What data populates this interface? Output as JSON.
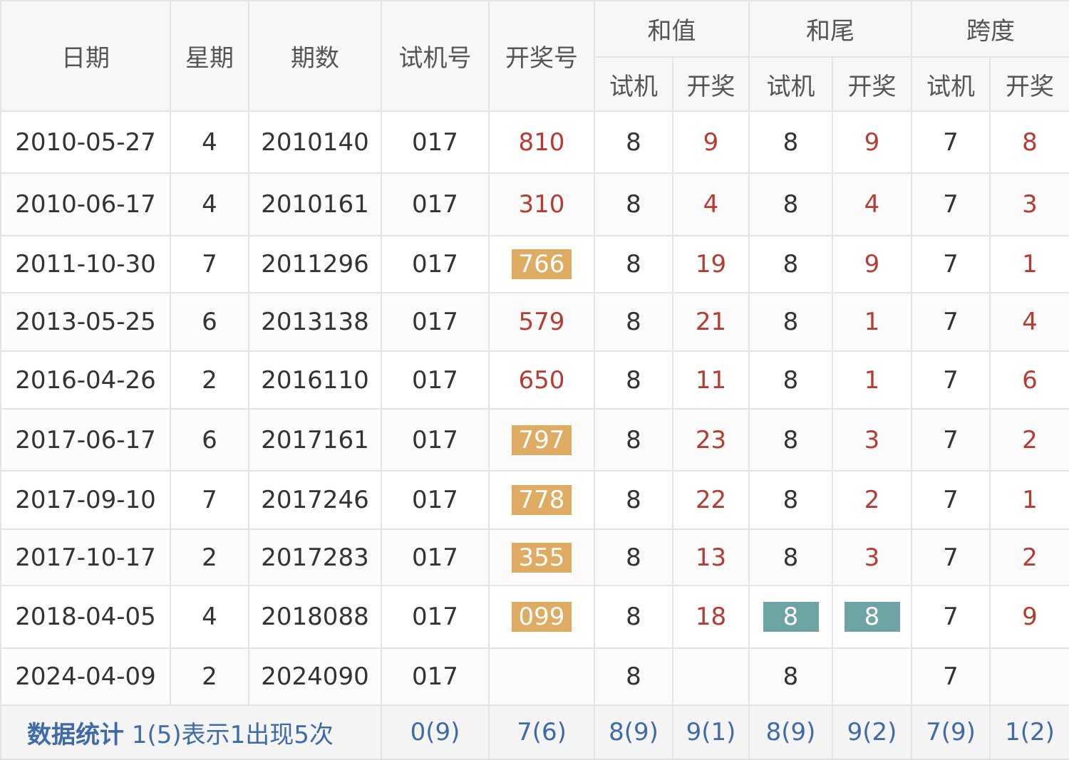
{
  "header": {
    "date": "日期",
    "weekday": "星期",
    "issue": "期数",
    "trial_number": "试机号",
    "draw_number": "开奖号",
    "sum_group": "和值",
    "tail_group": "和尾",
    "span_group": "跨度",
    "sub_trial": "试机",
    "sub_draw": "开奖"
  },
  "rows": [
    {
      "date": "2010-05-27",
      "weekday": "4",
      "issue": "2010140",
      "trial": "017",
      "draw": "810",
      "draw_hl": false,
      "sum_trial": "8",
      "sum_draw": "9",
      "tail_trial": "8",
      "tail_draw": "9",
      "tail_hl": false,
      "span_trial": "7",
      "span_draw": "8"
    },
    {
      "date": "2010-06-17",
      "weekday": "4",
      "issue": "2010161",
      "trial": "017",
      "draw": "310",
      "draw_hl": false,
      "sum_trial": "8",
      "sum_draw": "4",
      "tail_trial": "8",
      "tail_draw": "4",
      "tail_hl": false,
      "span_trial": "7",
      "span_draw": "3"
    },
    {
      "date": "2011-10-30",
      "weekday": "7",
      "issue": "2011296",
      "trial": "017",
      "draw": "766",
      "draw_hl": true,
      "sum_trial": "8",
      "sum_draw": "19",
      "tail_trial": "8",
      "tail_draw": "9",
      "tail_hl": false,
      "span_trial": "7",
      "span_draw": "1"
    },
    {
      "date": "2013-05-25",
      "weekday": "6",
      "issue": "2013138",
      "trial": "017",
      "draw": "579",
      "draw_hl": false,
      "sum_trial": "8",
      "sum_draw": "21",
      "tail_trial": "8",
      "tail_draw": "1",
      "tail_hl": false,
      "span_trial": "7",
      "span_draw": "4"
    },
    {
      "date": "2016-04-26",
      "weekday": "2",
      "issue": "2016110",
      "trial": "017",
      "draw": "650",
      "draw_hl": false,
      "sum_trial": "8",
      "sum_draw": "11",
      "tail_trial": "8",
      "tail_draw": "1",
      "tail_hl": false,
      "span_trial": "7",
      "span_draw": "6"
    },
    {
      "date": "2017-06-17",
      "weekday": "6",
      "issue": "2017161",
      "trial": "017",
      "draw": "797",
      "draw_hl": true,
      "sum_trial": "8",
      "sum_draw": "23",
      "tail_trial": "8",
      "tail_draw": "3",
      "tail_hl": false,
      "span_trial": "7",
      "span_draw": "2"
    },
    {
      "date": "2017-09-10",
      "weekday": "7",
      "issue": "2017246",
      "trial": "017",
      "draw": "778",
      "draw_hl": true,
      "sum_trial": "8",
      "sum_draw": "22",
      "tail_trial": "8",
      "tail_draw": "2",
      "tail_hl": false,
      "span_trial": "7",
      "span_draw": "1"
    },
    {
      "date": "2017-10-17",
      "weekday": "2",
      "issue": "2017283",
      "trial": "017",
      "draw": "355",
      "draw_hl": true,
      "sum_trial": "8",
      "sum_draw": "13",
      "tail_trial": "8",
      "tail_draw": "3",
      "tail_hl": false,
      "span_trial": "7",
      "span_draw": "2"
    },
    {
      "date": "2018-04-05",
      "weekday": "4",
      "issue": "2018088",
      "trial": "017",
      "draw": "099",
      "draw_hl": true,
      "sum_trial": "8",
      "sum_draw": "18",
      "tail_trial": "8",
      "tail_draw": "8",
      "tail_hl": true,
      "span_trial": "7",
      "span_draw": "9"
    },
    {
      "date": "2024-04-09",
      "weekday": "2",
      "issue": "2024090",
      "trial": "017",
      "draw": "",
      "draw_hl": false,
      "sum_trial": "8",
      "sum_draw": "",
      "tail_trial": "8",
      "tail_draw": "",
      "tail_hl": false,
      "span_trial": "7",
      "span_draw": ""
    }
  ],
  "footer": {
    "title": "数据统计",
    "note": "1(5)表示1出现5次",
    "trial": "0(9)",
    "draw": "7(6)",
    "sum_trial": "8(9)",
    "sum_draw": "9(1)",
    "tail_trial": "8(9)",
    "tail_draw": "9(2)",
    "span_trial": "7(9)",
    "span_draw": "1(2)"
  },
  "colors": {
    "highlight_orange": "#dfab62",
    "highlight_teal": "#6ea3a3",
    "draw_red": "#b83b33",
    "footer_blue": "#3f6aa8"
  }
}
